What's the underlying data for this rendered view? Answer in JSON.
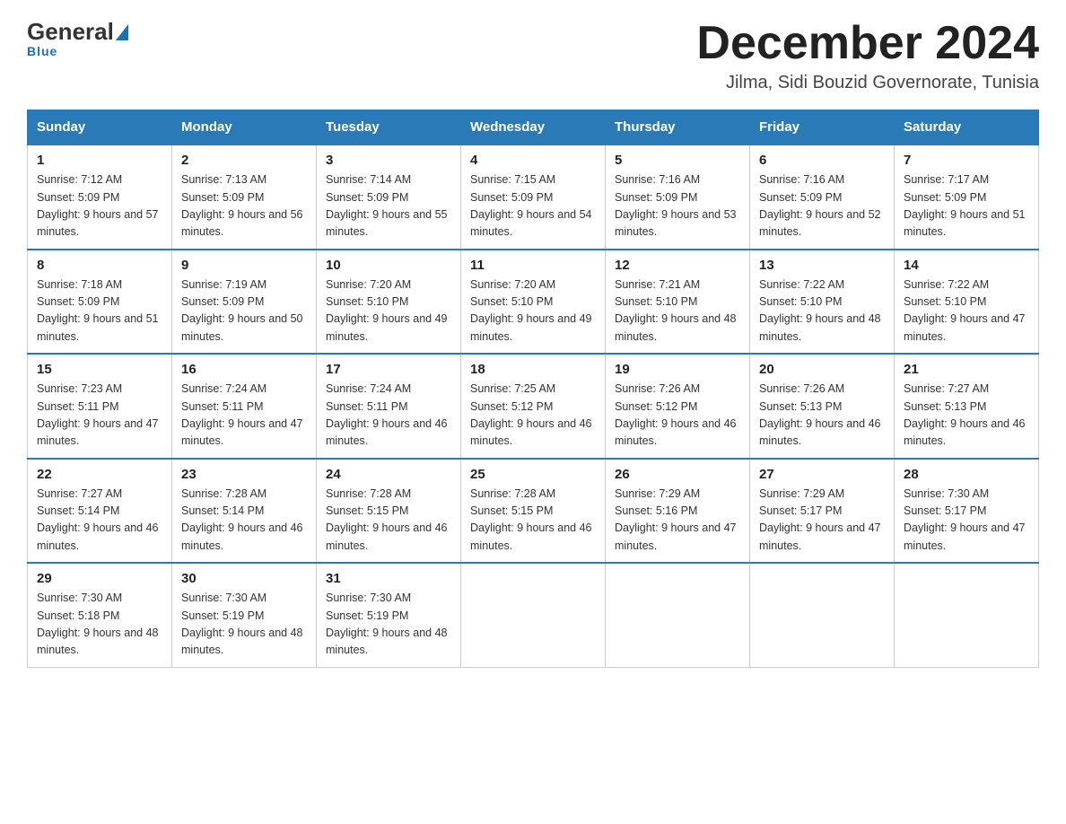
{
  "logo": {
    "general": "General",
    "blue": "Blue"
  },
  "header": {
    "title": "December 2024",
    "subtitle": "Jilma, Sidi Bouzid Governorate, Tunisia"
  },
  "days_of_week": [
    "Sunday",
    "Monday",
    "Tuesday",
    "Wednesday",
    "Thursday",
    "Friday",
    "Saturday"
  ],
  "weeks": [
    [
      {
        "num": "1",
        "sunrise": "7:12 AM",
        "sunset": "5:09 PM",
        "daylight": "9 hours and 57 minutes."
      },
      {
        "num": "2",
        "sunrise": "7:13 AM",
        "sunset": "5:09 PM",
        "daylight": "9 hours and 56 minutes."
      },
      {
        "num": "3",
        "sunrise": "7:14 AM",
        "sunset": "5:09 PM",
        "daylight": "9 hours and 55 minutes."
      },
      {
        "num": "4",
        "sunrise": "7:15 AM",
        "sunset": "5:09 PM",
        "daylight": "9 hours and 54 minutes."
      },
      {
        "num": "5",
        "sunrise": "7:16 AM",
        "sunset": "5:09 PM",
        "daylight": "9 hours and 53 minutes."
      },
      {
        "num": "6",
        "sunrise": "7:16 AM",
        "sunset": "5:09 PM",
        "daylight": "9 hours and 52 minutes."
      },
      {
        "num": "7",
        "sunrise": "7:17 AM",
        "sunset": "5:09 PM",
        "daylight": "9 hours and 51 minutes."
      }
    ],
    [
      {
        "num": "8",
        "sunrise": "7:18 AM",
        "sunset": "5:09 PM",
        "daylight": "9 hours and 51 minutes."
      },
      {
        "num": "9",
        "sunrise": "7:19 AM",
        "sunset": "5:09 PM",
        "daylight": "9 hours and 50 minutes."
      },
      {
        "num": "10",
        "sunrise": "7:20 AM",
        "sunset": "5:10 PM",
        "daylight": "9 hours and 49 minutes."
      },
      {
        "num": "11",
        "sunrise": "7:20 AM",
        "sunset": "5:10 PM",
        "daylight": "9 hours and 49 minutes."
      },
      {
        "num": "12",
        "sunrise": "7:21 AM",
        "sunset": "5:10 PM",
        "daylight": "9 hours and 48 minutes."
      },
      {
        "num": "13",
        "sunrise": "7:22 AM",
        "sunset": "5:10 PM",
        "daylight": "9 hours and 48 minutes."
      },
      {
        "num": "14",
        "sunrise": "7:22 AM",
        "sunset": "5:10 PM",
        "daylight": "9 hours and 47 minutes."
      }
    ],
    [
      {
        "num": "15",
        "sunrise": "7:23 AM",
        "sunset": "5:11 PM",
        "daylight": "9 hours and 47 minutes."
      },
      {
        "num": "16",
        "sunrise": "7:24 AM",
        "sunset": "5:11 PM",
        "daylight": "9 hours and 47 minutes."
      },
      {
        "num": "17",
        "sunrise": "7:24 AM",
        "sunset": "5:11 PM",
        "daylight": "9 hours and 46 minutes."
      },
      {
        "num": "18",
        "sunrise": "7:25 AM",
        "sunset": "5:12 PM",
        "daylight": "9 hours and 46 minutes."
      },
      {
        "num": "19",
        "sunrise": "7:26 AM",
        "sunset": "5:12 PM",
        "daylight": "9 hours and 46 minutes."
      },
      {
        "num": "20",
        "sunrise": "7:26 AM",
        "sunset": "5:13 PM",
        "daylight": "9 hours and 46 minutes."
      },
      {
        "num": "21",
        "sunrise": "7:27 AM",
        "sunset": "5:13 PM",
        "daylight": "9 hours and 46 minutes."
      }
    ],
    [
      {
        "num": "22",
        "sunrise": "7:27 AM",
        "sunset": "5:14 PM",
        "daylight": "9 hours and 46 minutes."
      },
      {
        "num": "23",
        "sunrise": "7:28 AM",
        "sunset": "5:14 PM",
        "daylight": "9 hours and 46 minutes."
      },
      {
        "num": "24",
        "sunrise": "7:28 AM",
        "sunset": "5:15 PM",
        "daylight": "9 hours and 46 minutes."
      },
      {
        "num": "25",
        "sunrise": "7:28 AM",
        "sunset": "5:15 PM",
        "daylight": "9 hours and 46 minutes."
      },
      {
        "num": "26",
        "sunrise": "7:29 AM",
        "sunset": "5:16 PM",
        "daylight": "9 hours and 47 minutes."
      },
      {
        "num": "27",
        "sunrise": "7:29 AM",
        "sunset": "5:17 PM",
        "daylight": "9 hours and 47 minutes."
      },
      {
        "num": "28",
        "sunrise": "7:30 AM",
        "sunset": "5:17 PM",
        "daylight": "9 hours and 47 minutes."
      }
    ],
    [
      {
        "num": "29",
        "sunrise": "7:30 AM",
        "sunset": "5:18 PM",
        "daylight": "9 hours and 48 minutes."
      },
      {
        "num": "30",
        "sunrise": "7:30 AM",
        "sunset": "5:19 PM",
        "daylight": "9 hours and 48 minutes."
      },
      {
        "num": "31",
        "sunrise": "7:30 AM",
        "sunset": "5:19 PM",
        "daylight": "9 hours and 48 minutes."
      },
      null,
      null,
      null,
      null
    ]
  ]
}
